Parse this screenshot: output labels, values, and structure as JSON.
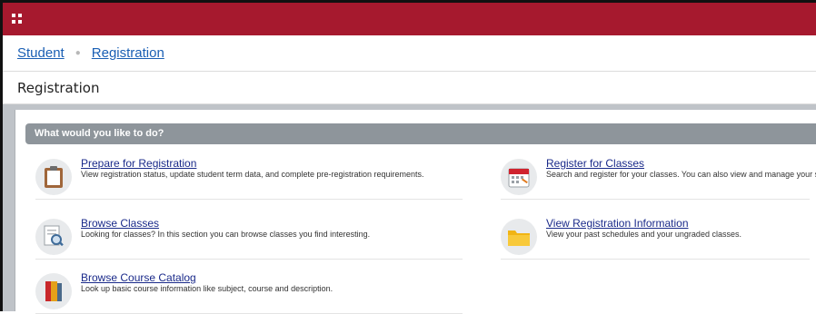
{
  "header": {
    "app_menu_icon": "grid-menu-icon",
    "color": "#a6192e"
  },
  "breadcrumb": {
    "items": [
      "Student",
      "Registration"
    ]
  },
  "page_title": "Registration",
  "section": {
    "title": "What would you like to do?"
  },
  "items": [
    {
      "icon": "clipboard-icon",
      "label": "Prepare for Registration",
      "description": "View registration status, update student term data, and complete pre-registration requirements."
    },
    {
      "icon": "calendar-icon",
      "label": "Register for Classes",
      "description": "Search and register for your classes. You can also view and manage your schedule."
    },
    {
      "icon": "document-search-icon",
      "label": "Browse Classes",
      "description": "Looking for classes? In this section you can browse classes you find interesting."
    },
    {
      "icon": "folder-icon",
      "label": "View Registration Information",
      "description": "View your past schedules and your ungraded classes."
    },
    {
      "icon": "book-icon",
      "label": "Browse Course Catalog",
      "description": "Look up basic course information like subject, course and description."
    }
  ]
}
